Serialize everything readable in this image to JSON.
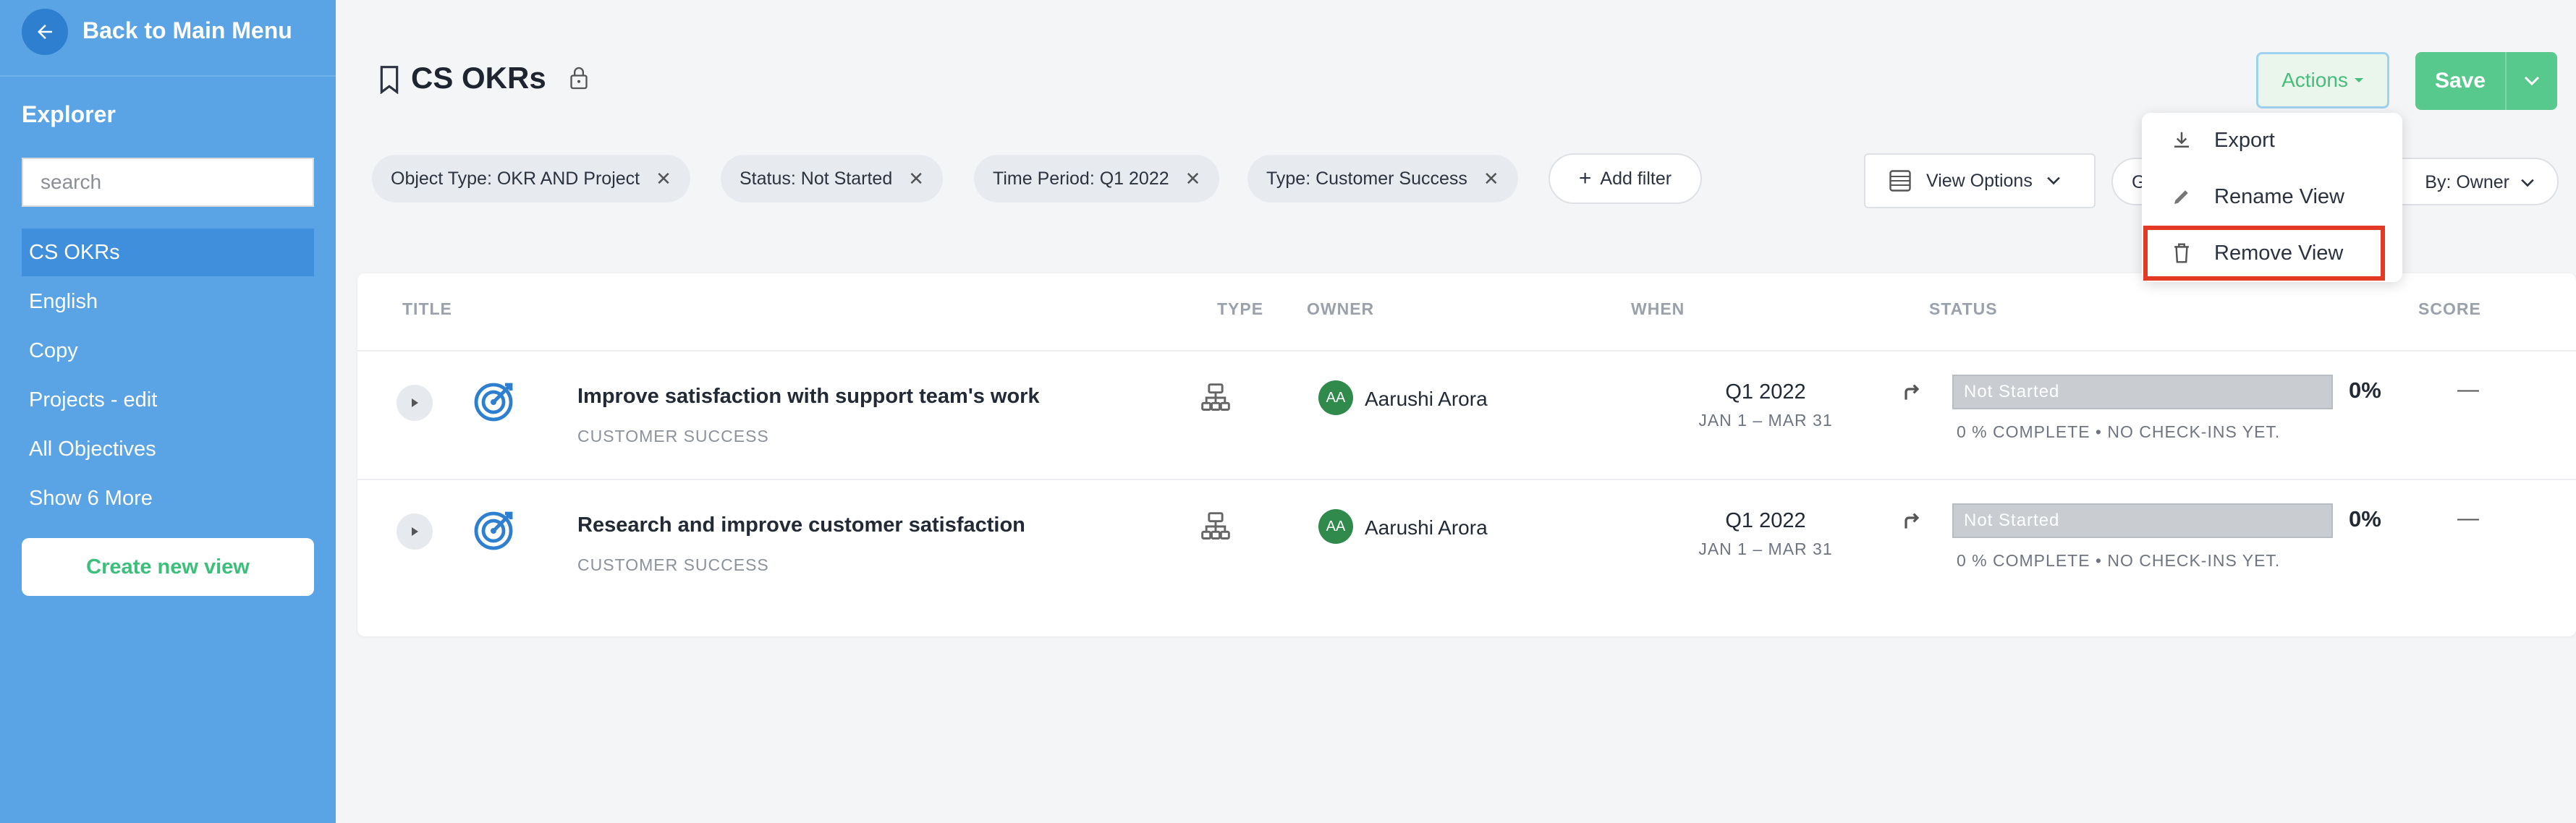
{
  "sidebar": {
    "back_label": "Back to Main Menu",
    "explorer_title": "Explorer",
    "search_placeholder": "search",
    "items": [
      {
        "label": "CS OKRs"
      },
      {
        "label": "English"
      },
      {
        "label": "Copy"
      },
      {
        "label": "Projects - edit"
      },
      {
        "label": "All Objectives"
      },
      {
        "label": "Show 6 More"
      }
    ],
    "create_label": "Create new view"
  },
  "header": {
    "title": "CS OKRs",
    "actions_label": "Actions",
    "save_label": "Save"
  },
  "filters": [
    {
      "label": "Object Type: OKR AND Project"
    },
    {
      "label": "Status: Not Started"
    },
    {
      "label": "Time Period: Q1 2022"
    },
    {
      "label": "Type: Customer Success"
    }
  ],
  "add_filter_label": "Add filter",
  "view_options_label": "View Options",
  "group_by": {
    "left": "G",
    "right": "By: Owner"
  },
  "actions_menu": [
    {
      "label": "Export"
    },
    {
      "label": "Rename View"
    },
    {
      "label": "Remove View"
    }
  ],
  "table": {
    "columns": {
      "title": "TITLE",
      "type": "TYPE",
      "owner": "OWNER",
      "when": "WHEN",
      "status": "STATUS",
      "score": "SCORE"
    },
    "rows": [
      {
        "title": "Improve satisfaction with support team's work",
        "subtitle": "CUSTOMER SUCCESS",
        "owner_initials": "AA",
        "owner": "Aarushi Arora",
        "when": "Q1 2022",
        "when_range": "JAN 1 – MAR 31",
        "status": "Not Started",
        "percent": "0%",
        "progress_note": "0  % COMPLETE • NO CHECK-INS YET.",
        "score": "—"
      },
      {
        "title": "Research and improve customer satisfaction",
        "subtitle": "CUSTOMER SUCCESS",
        "owner_initials": "AA",
        "owner": "Aarushi Arora",
        "when": "Q1 2022",
        "when_range": "JAN 1 – MAR 31",
        "status": "Not Started",
        "percent": "0%",
        "progress_note": "0  % COMPLETE • NO CHECK-INS YET.",
        "score": "—"
      }
    ]
  },
  "colors": {
    "sidebar": "#5aa3e4",
    "sidebar_active": "#3f8fdd",
    "accent_green": "#58c98d",
    "highlight_red": "#e23a25",
    "target_blue": "#2f7fd0"
  }
}
